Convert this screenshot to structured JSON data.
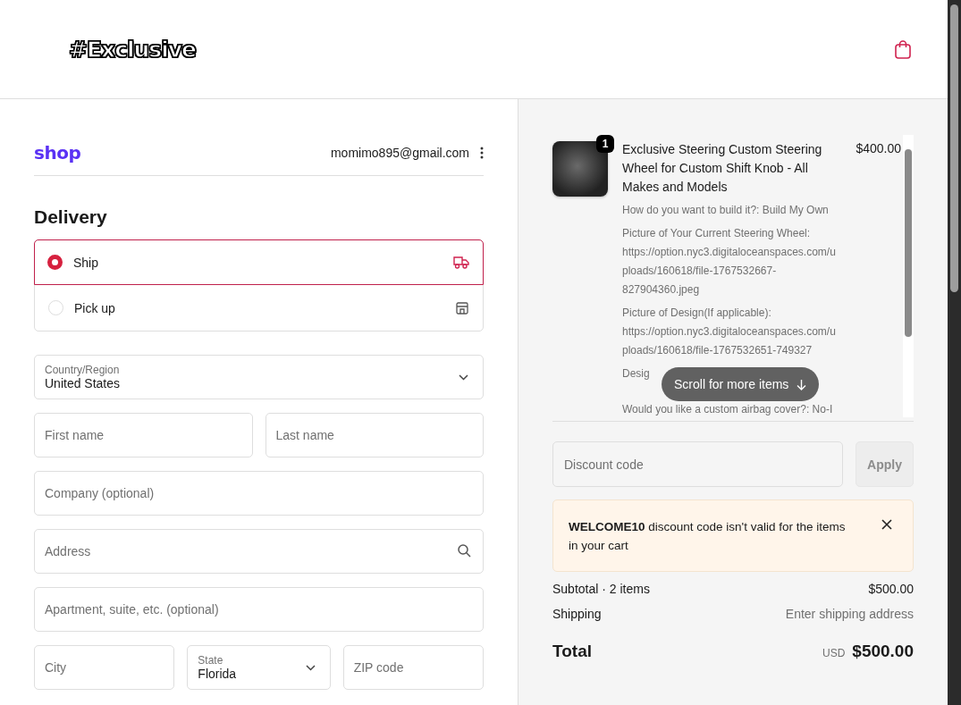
{
  "header": {
    "logo": "#Exclusive"
  },
  "account": {
    "brand": "shop",
    "email": "momimo895@gmail.com"
  },
  "delivery": {
    "title": "Delivery",
    "options": [
      {
        "label": "Ship",
        "selected": true,
        "kind": "ship"
      },
      {
        "label": "Pick up",
        "selected": false,
        "kind": "pickup"
      }
    ]
  },
  "form": {
    "rows": [
      [
        {
          "kind": "select",
          "label": "Country/Region",
          "value": "United States"
        }
      ],
      [
        {
          "kind": "text",
          "placeholder": "First name"
        },
        {
          "kind": "text",
          "placeholder": "Last name"
        }
      ],
      [
        {
          "kind": "text",
          "placeholder": "Company (optional)"
        }
      ],
      [
        {
          "kind": "search",
          "placeholder": "Address"
        }
      ],
      [
        {
          "kind": "text",
          "placeholder": "Apartment, suite, etc. (optional)"
        }
      ],
      [
        {
          "kind": "text",
          "placeholder": "City"
        },
        {
          "kind": "select",
          "label": "State",
          "value": "Florida"
        },
        {
          "kind": "text",
          "placeholder": "ZIP code"
        }
      ]
    ]
  },
  "order": {
    "items": [
      {
        "quantity": "1",
        "title": "Exclusive Steering Custom Steering Wheel for Custom Shift Knob - All Makes and Models",
        "price": "$400.00",
        "properties": [
          "How do you want to build it?: Build My Own",
          "Picture of Your Current Steering Wheel: https://option.nyc3.digitaloceanspaces.com/uploads/160618/file-1767532667-827904360.jpeg",
          "Picture of Design(If applicable): https://option.nyc3.digitaloceanspaces.com/uploads/160618/file-1767532651-749327",
          "Desig",
          "Would you like a custom airbag cover?: No-I"
        ]
      }
    ],
    "scroll_hint": "Scroll for more items"
  },
  "discount": {
    "placeholder": "Discount code",
    "button": "Apply",
    "disabled": true
  },
  "notice": {
    "text": "**WELCOME10** discount code isn't valid for the items in your cart"
  },
  "summary": {
    "rows": [
      {
        "label": "Subtotal · 2 items",
        "value": "$500.00",
        "kind": "amount"
      },
      {
        "label": "Shipping",
        "value": "Enter shipping address",
        "kind": "hint"
      }
    ],
    "total": {
      "label": "Total",
      "currency": "USD",
      "value": "$500.00"
    }
  }
}
